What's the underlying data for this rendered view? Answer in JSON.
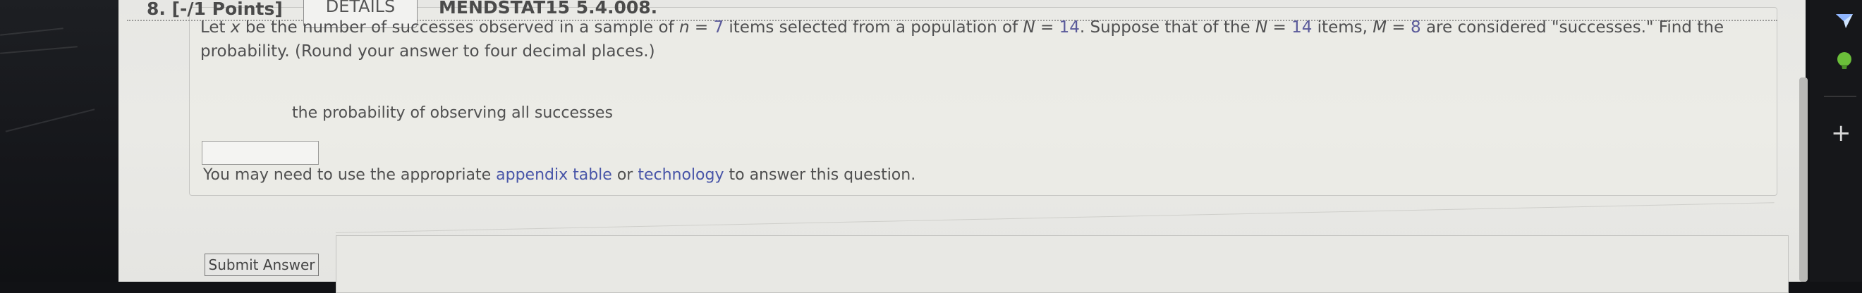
{
  "question": {
    "number_label": "8. [-/1 Points]",
    "details_tab": "DETAILS",
    "reference": "MENDSTAT15 5.4.008."
  },
  "prompt": {
    "part1": "Let ",
    "x_var": "x",
    "part2": " be the number of successes observed in a sample of ",
    "n_var": "n",
    "eq1": " = ",
    "n_val": "7",
    "part3": " items selected from a population of ",
    "N_var": "N",
    "eq2": " = ",
    "N_val": "14",
    "part4": ". Suppose that of the ",
    "N_var2": "N",
    "eq3": " = ",
    "N_val2": "14",
    "part5": " items, ",
    "M_var": "M",
    "eq4": " = ",
    "M_val": "8",
    "part6": " are considered \"successes.\" Find the probability. (Round your answer to four decimal places.)"
  },
  "sub_prompt": "the probability of observing all successes",
  "answer_input": {
    "value": "",
    "placeholder": ""
  },
  "help": {
    "pre": "You may need to use the appropriate ",
    "link1": "appendix table",
    "mid": " or ",
    "link2": "technology",
    "post": " to answer this question."
  },
  "submit_label": "Submit Answer",
  "sidebar": {
    "plus_label": "+",
    "icons": [
      "send-icon",
      "lightbulb-icon"
    ]
  },
  "colors": {
    "link": "#4855a8",
    "text": "#4f4f50",
    "page_bg": "#e7e7e4",
    "bezel": "#16171a"
  }
}
